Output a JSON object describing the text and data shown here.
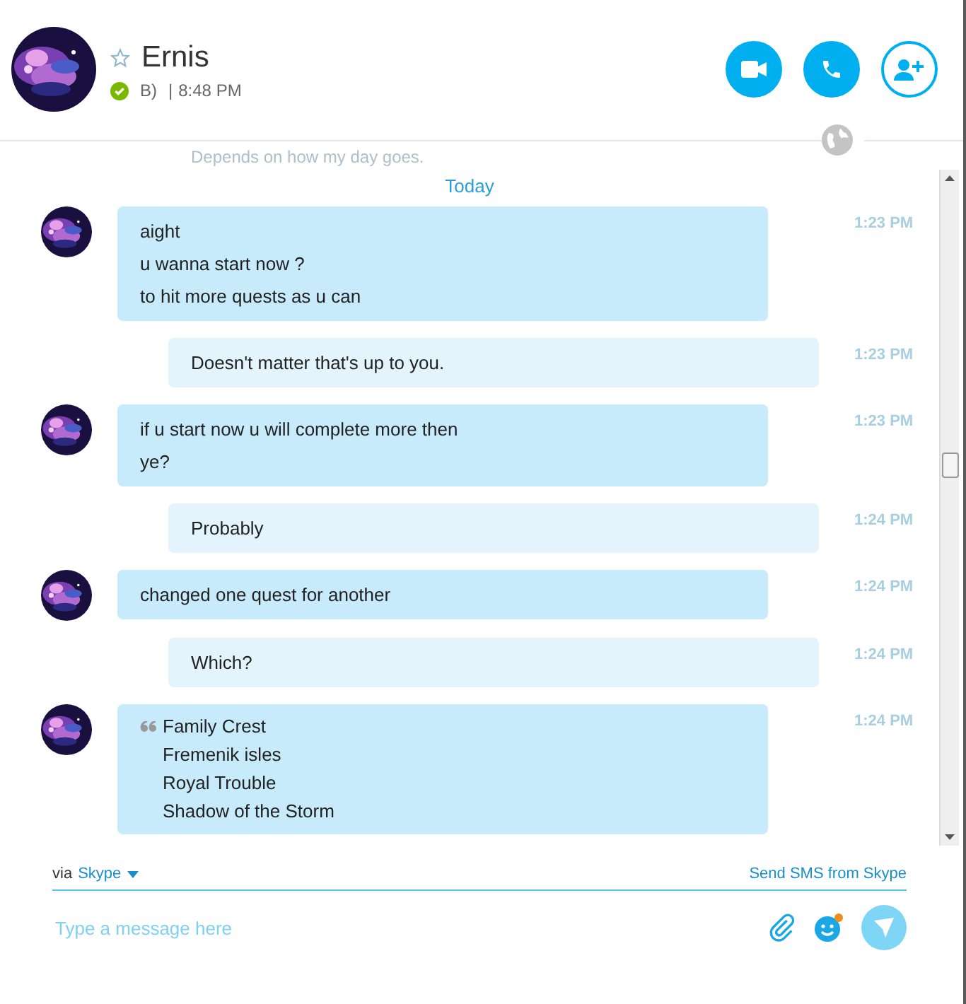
{
  "contact": {
    "name": "Ernis",
    "favorite": false,
    "online": true,
    "mood": "B)",
    "separator": "|",
    "local_time": "8:48 PM"
  },
  "actions": [
    {
      "kind": "video"
    },
    {
      "kind": "call"
    },
    {
      "kind": "add"
    }
  ],
  "faded_message": "Depends on how my day goes.",
  "day_label": "Today",
  "messages": [
    {
      "outgoing": false,
      "kind": "text",
      "lines": [
        "aight",
        "u wanna start now ?",
        "to hit more quests as u can"
      ],
      "time": "1:23 PM"
    },
    {
      "outgoing": true,
      "kind": "text",
      "lines": [
        "Doesn't matter that's up to you."
      ],
      "time": "1:23 PM"
    },
    {
      "outgoing": false,
      "kind": "text",
      "lines": [
        "if u start now u will complete more then",
        "ye?"
      ],
      "time": "1:23 PM"
    },
    {
      "outgoing": true,
      "kind": "text",
      "lines": [
        "Probably"
      ],
      "time": "1:24 PM"
    },
    {
      "outgoing": false,
      "kind": "text",
      "lines": [
        "changed one quest for another"
      ],
      "time": "1:24 PM"
    },
    {
      "outgoing": true,
      "kind": "text",
      "lines": [
        "Which?"
      ],
      "time": "1:24 PM"
    },
    {
      "outgoing": false,
      "kind": "quote",
      "lines": [
        "Family Crest",
        "Fremenik isles",
        "Royal Trouble",
        "Shadow of the Storm"
      ],
      "time": "1:24 PM"
    }
  ],
  "composer": {
    "via": "via",
    "service": "Skype",
    "sms_link": "Send SMS from Skype",
    "placeholder": "Type a message here"
  }
}
